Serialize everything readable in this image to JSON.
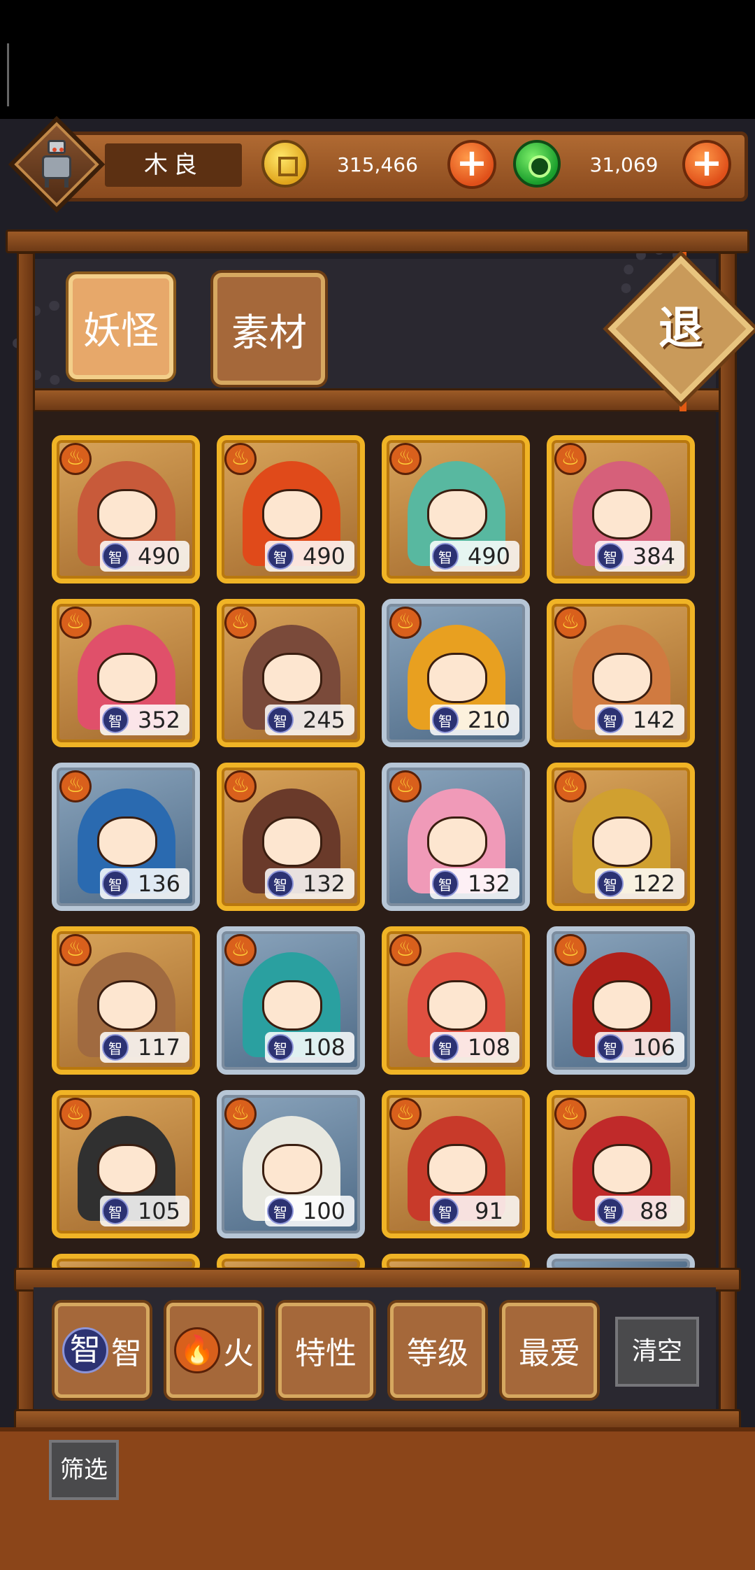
{
  "player": {
    "name": "木良"
  },
  "currency": {
    "coins": "315,466",
    "jade": "31,069"
  },
  "tabs": [
    {
      "label": "妖怪"
    },
    {
      "label": "素材"
    }
  ],
  "exit_label": "退",
  "cards": [
    {
      "value": "490",
      "frame": "gold"
    },
    {
      "value": "490",
      "frame": "gold"
    },
    {
      "value": "490",
      "frame": "gold"
    },
    {
      "value": "384",
      "frame": "gold"
    },
    {
      "value": "352",
      "frame": "gold"
    },
    {
      "value": "245",
      "frame": "gold"
    },
    {
      "value": "210",
      "frame": "silver"
    },
    {
      "value": "142",
      "frame": "gold"
    },
    {
      "value": "136",
      "frame": "silver"
    },
    {
      "value": "132",
      "frame": "gold"
    },
    {
      "value": "132",
      "frame": "silver"
    },
    {
      "value": "122",
      "frame": "gold"
    },
    {
      "value": "117",
      "frame": "gold"
    },
    {
      "value": "108",
      "frame": "silver"
    },
    {
      "value": "108",
      "frame": "gold"
    },
    {
      "value": "106",
      "frame": "silver"
    },
    {
      "value": "105",
      "frame": "gold"
    },
    {
      "value": "100",
      "frame": "silver"
    },
    {
      "value": "91",
      "frame": "gold"
    },
    {
      "value": "88",
      "frame": "gold"
    }
  ],
  "stat_badge_label": "智",
  "fire_badge_icon": "fire-icon",
  "filters": [
    {
      "label": "智",
      "icon": "intelligence-icon"
    },
    {
      "label": "火",
      "icon": "fire-icon"
    },
    {
      "label": "特性"
    },
    {
      "label": "等级"
    },
    {
      "label": "最爱"
    }
  ],
  "clear_label": "清空",
  "screen_label": "筛选",
  "colors": {
    "gold_frame": "#f0b426",
    "silver_frame": "#b7c6d6",
    "wood": "#8b4519",
    "plus": "#e0501a"
  }
}
